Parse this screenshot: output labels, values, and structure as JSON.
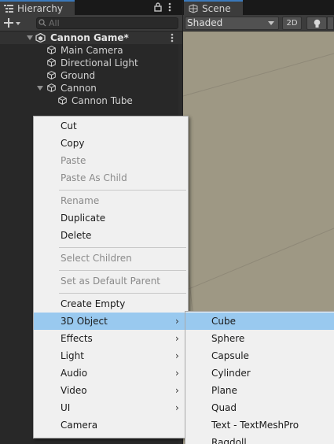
{
  "hierarchy": {
    "tab_label": "Hierarchy",
    "search_placeholder": "All",
    "scene_name": "Cannon Game*",
    "items": [
      {
        "label": "Main Camera"
      },
      {
        "label": "Directional Light"
      },
      {
        "label": "Ground"
      },
      {
        "label": "Cannon"
      },
      {
        "label": "Cannon Tube"
      }
    ]
  },
  "scene_view": {
    "tab_label": "Scene",
    "shading_mode": "Shaded",
    "toggle_2d": "2D"
  },
  "context_menu": {
    "items": [
      {
        "label": "Cut",
        "enabled": true
      },
      {
        "label": "Copy",
        "enabled": true
      },
      {
        "label": "Paste",
        "enabled": false
      },
      {
        "label": "Paste As Child",
        "enabled": false
      },
      {
        "label": "Rename",
        "enabled": false
      },
      {
        "label": "Duplicate",
        "enabled": true
      },
      {
        "label": "Delete",
        "enabled": true
      },
      {
        "label": "Select Children",
        "enabled": false
      },
      {
        "label": "Set as Default Parent",
        "enabled": false
      },
      {
        "label": "Create Empty",
        "enabled": true
      },
      {
        "label": "3D Object",
        "enabled": true,
        "submenu": true,
        "highlighted": true
      },
      {
        "label": "Effects",
        "enabled": true,
        "submenu": true
      },
      {
        "label": "Light",
        "enabled": true,
        "submenu": true
      },
      {
        "label": "Audio",
        "enabled": true,
        "submenu": true
      },
      {
        "label": "Video",
        "enabled": true,
        "submenu": true
      },
      {
        "label": "UI",
        "enabled": true,
        "submenu": true
      },
      {
        "label": "Camera",
        "enabled": true
      }
    ],
    "submenu_arrow": "›"
  },
  "submenu_3d_object": {
    "items": [
      {
        "label": "Cube",
        "highlighted": true
      },
      {
        "label": "Sphere"
      },
      {
        "label": "Capsule"
      },
      {
        "label": "Cylinder"
      },
      {
        "label": "Plane"
      },
      {
        "label": "Quad"
      },
      {
        "label": "Text - TextMeshPro"
      },
      {
        "label": "Ragdoll"
      }
    ]
  },
  "colors": {
    "panel_bg": "#282828",
    "scene_bg": "#9e9884",
    "menu_bg": "#f0f0f0",
    "menu_highlight": "#99c9ef",
    "tab_accent": "#3a79bb"
  }
}
